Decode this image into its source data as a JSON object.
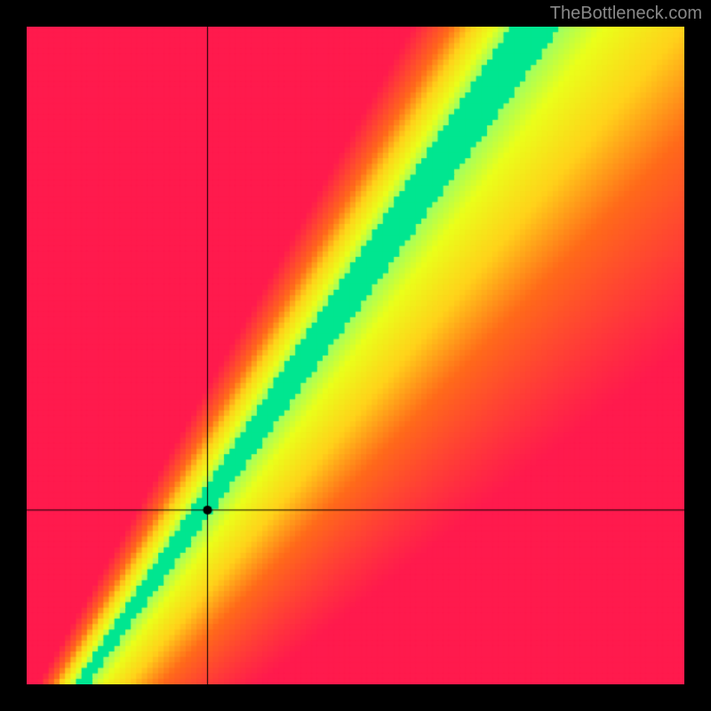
{
  "watermark": "TheBottleneck.com",
  "chart_data": {
    "type": "heatmap",
    "title": "",
    "xlabel": "",
    "ylabel": "",
    "xlim": [
      0,
      1
    ],
    "ylim": [
      0,
      1
    ],
    "crosshair": {
      "x": 0.275,
      "y": 0.265
    },
    "point": {
      "x": 0.275,
      "y": 0.265
    },
    "optimal_band": {
      "description": "Green diagonal band from bottom-left to top-right, slightly steeper than 45 degrees, narrowing toward bottom-left and widening slightly toward top-right",
      "slope_approx": 1.45,
      "intercept_approx": -0.12,
      "halfwidth_at_0": 0.01,
      "halfwidth_at_1": 0.07
    },
    "colormap": {
      "stops": [
        {
          "t": 0.0,
          "color": "#ff1a4d"
        },
        {
          "t": 0.35,
          "color": "#ff6a1a"
        },
        {
          "t": 0.55,
          "color": "#ffd21a"
        },
        {
          "t": 0.75,
          "color": "#eaff1a"
        },
        {
          "t": 0.88,
          "color": "#a0ff60"
        },
        {
          "t": 1.0,
          "color": "#00e690"
        }
      ]
    },
    "pixel_resolution": 120
  }
}
